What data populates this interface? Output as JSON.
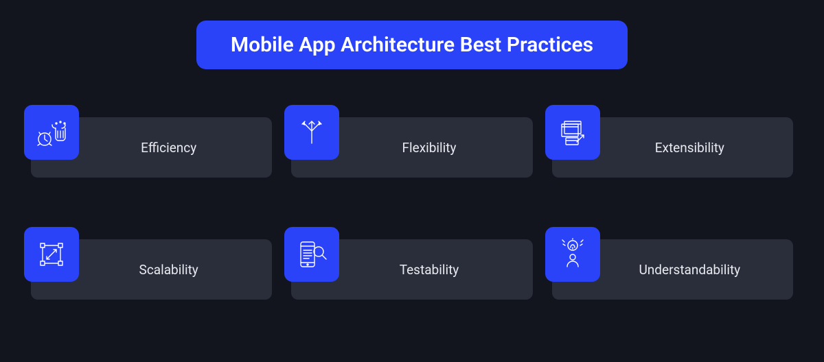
{
  "title": "Mobile App Architecture Best Practices",
  "cards": [
    {
      "label": "Efficiency"
    },
    {
      "label": "Flexibility"
    },
    {
      "label": "Extensibility"
    },
    {
      "label": "Scalability"
    },
    {
      "label": "Testability"
    },
    {
      "label": "Understandability"
    }
  ]
}
